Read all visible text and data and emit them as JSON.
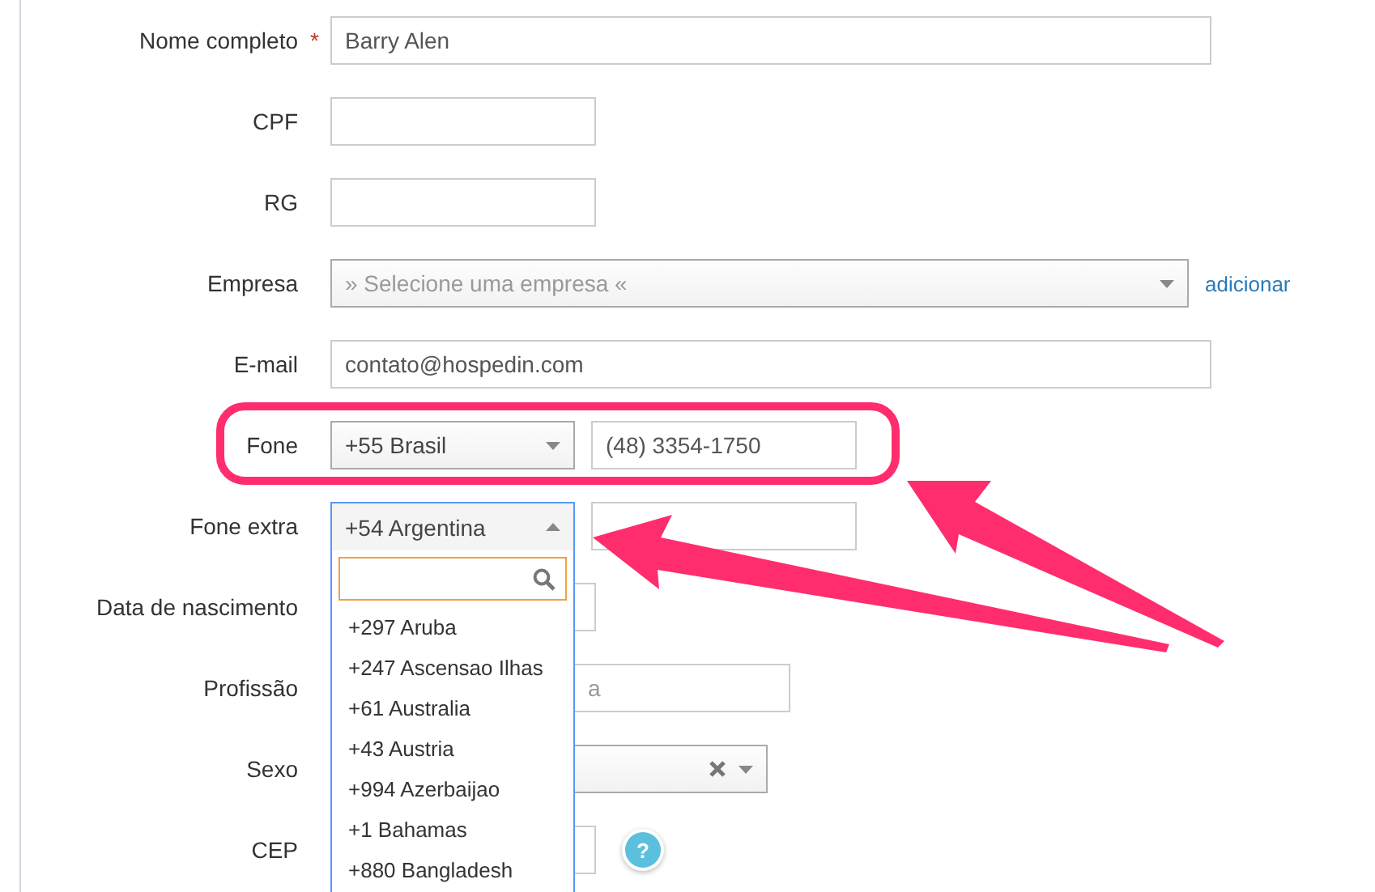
{
  "form": {
    "fields": [
      {
        "kind": "text",
        "label": "Nome completo",
        "required_mark": "*",
        "value": "Barry Alen"
      },
      {
        "kind": "text",
        "label": "CPF"
      },
      {
        "kind": "text",
        "label": "RG"
      },
      {
        "kind": "select",
        "label": "Empresa",
        "placeholder": "» Selecione uma empresa «",
        "link": "adicionar"
      },
      {
        "kind": "text",
        "label": "E-mail",
        "value": "contato@hospedin.com"
      },
      {
        "kind": "phone",
        "label": "Fone",
        "country": "+55 Brasil",
        "expanded": false,
        "number": "(48) 3354-1750"
      },
      {
        "kind": "phone",
        "label": "Fone extra",
        "country": "+54 Argentina",
        "expanded": true,
        "options": [
          "+297 Aruba",
          "+247 Ascensao Ilhas",
          "+61 Australia",
          "+43 Austria",
          "+994 Azerbaijao",
          "+1 Bahamas",
          "+880 Bangladesh"
        ]
      },
      {
        "kind": "text",
        "label": "Data de nascimento"
      },
      {
        "kind": "text",
        "label": "Profissão",
        "value_tail": "a"
      },
      {
        "kind": "select",
        "label": "Sexo",
        "clearable": true
      },
      {
        "kind": "text",
        "label": "CEP",
        "help": "?"
      }
    ]
  }
}
